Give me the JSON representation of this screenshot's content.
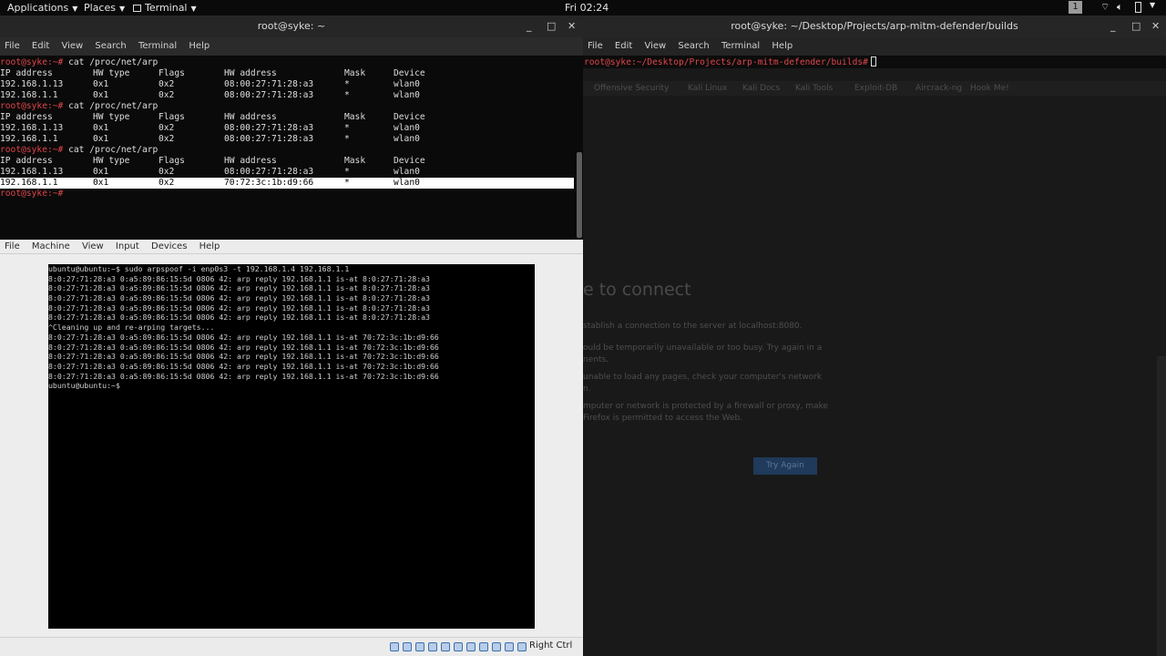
{
  "topbar": {
    "applications": "Applications",
    "places": "Places",
    "terminal": "Terminal",
    "clock": "Fri 02:24",
    "workspace": "1"
  },
  "left_terminal": {
    "title": "root@syke: ~",
    "menu": [
      "File",
      "Edit",
      "View",
      "Search",
      "Terminal",
      "Help"
    ],
    "prompt": "root@syke:~#",
    "command": " cat /proc/net/arp",
    "headers": [
      "IP address",
      "HW type",
      "Flags",
      "HW address",
      "Mask",
      "Device"
    ],
    "blocks": [
      [
        [
          "192.168.1.13",
          "0x1",
          "0x2",
          "08:00:27:71:28:a3",
          "*",
          "wlan0"
        ],
        [
          "192.168.1.1",
          "0x1",
          "0x2",
          "08:00:27:71:28:a3",
          "*",
          "wlan0"
        ]
      ],
      [
        [
          "192.168.1.13",
          "0x1",
          "0x2",
          "08:00:27:71:28:a3",
          "*",
          "wlan0"
        ],
        [
          "192.168.1.1",
          "0x1",
          "0x2",
          "08:00:27:71:28:a3",
          "*",
          "wlan0"
        ]
      ],
      [
        [
          "192.168.1.13",
          "0x1",
          "0x2",
          "08:00:27:71:28:a3",
          "*",
          "wlan0"
        ],
        [
          "192.168.1.1",
          "0x1",
          "0x2",
          "70:72:3c:1b:d9:66",
          "*",
          "wlan0"
        ]
      ]
    ]
  },
  "right_terminal": {
    "title": "root@syke: ~/Desktop/Projects/arp-mitm-defender/builds",
    "menu": [
      "File",
      "Edit",
      "View",
      "Search",
      "Terminal",
      "Help"
    ],
    "prompt": "root@syke:~/Desktop/Projects/arp-mitm-defender/builds#"
  },
  "browser_bg": {
    "heading": "e to connect",
    "p1": "stablish a connection to the server at localhost:8080.",
    "p2a": "ould be temporarily unavailable or too busy. Try again in a",
    "p2b": "nents.",
    "p3a": "unable to load any pages, check your computer's network",
    "p3b": "n.",
    "p4a": "mputer or network is protected by a firewall or proxy, make",
    "p4b": "Firefox is permitted to access the Web.",
    "button": "Try Again",
    "bookmarks": [
      "Offensive Security",
      "Kali Linux",
      "Kali Docs",
      "Kali Tools",
      "Exploit-DB",
      "Aircrack-ng",
      "Hook Me!"
    ]
  },
  "vbox": {
    "menu": [
      "File",
      "Machine",
      "View",
      "Input",
      "Devices",
      "Help"
    ],
    "host_key": "Right Ctrl",
    "vm_lines": [
      "ubuntu@ubuntu:~$ sudo arpspoof -i enp0s3 -t 192.168.1.4 192.168.1.1",
      "8:0:27:71:28:a3 0:a5:89:86:15:5d 0806 42: arp reply 192.168.1.1 is-at 8:0:27:71:28:a3",
      "8:0:27:71:28:a3 0:a5:89:86:15:5d 0806 42: arp reply 192.168.1.1 is-at 8:0:27:71:28:a3",
      "8:0:27:71:28:a3 0:a5:89:86:15:5d 0806 42: arp reply 192.168.1.1 is-at 8:0:27:71:28:a3",
      "8:0:27:71:28:a3 0:a5:89:86:15:5d 0806 42: arp reply 192.168.1.1 is-at 8:0:27:71:28:a3",
      "8:0:27:71:28:a3 0:a5:89:86:15:5d 0806 42: arp reply 192.168.1.1 is-at 8:0:27:71:28:a3",
      "^Cleaning up and re-arping targets...",
      "8:0:27:71:28:a3 0:a5:89:86:15:5d 0806 42: arp reply 192.168.1.1 is-at 70:72:3c:1b:d9:66",
      "8:0:27:71:28:a3 0:a5:89:86:15:5d 0806 42: arp reply 192.168.1.1 is-at 70:72:3c:1b:d9:66",
      "8:0:27:71:28:a3 0:a5:89:86:15:5d 0806 42: arp reply 192.168.1.1 is-at 70:72:3c:1b:d9:66",
      "8:0:27:71:28:a3 0:a5:89:86:15:5d 0806 42: arp reply 192.168.1.1 is-at 70:72:3c:1b:d9:66",
      "8:0:27:71:28:a3 0:a5:89:86:15:5d 0806 42: arp reply 192.168.1.1 is-at 70:72:3c:1b:d9:66",
      "ubuntu@ubuntu:~$"
    ]
  },
  "colors": {
    "prompt": "#e0464b",
    "selection": "#ffffff",
    "terminal_bg": "#0a0a0a"
  }
}
